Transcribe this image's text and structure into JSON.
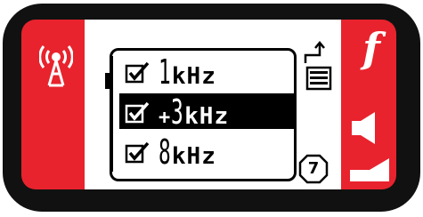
{
  "device": {
    "colors": {
      "frame": "#111111",
      "panel": "#e8232d",
      "screen": "#ffffff",
      "highlight": "#000000"
    }
  },
  "left_button": {
    "icon": "antenna-icon"
  },
  "menu": {
    "items": [
      {
        "checked": true,
        "prefix": "",
        "number": "1",
        "unit": "kHz",
        "selected": false
      },
      {
        "checked": true,
        "prefix": "+",
        "number": "3",
        "unit": "kHz",
        "selected": true
      },
      {
        "checked": true,
        "prefix": "",
        "number": "8",
        "unit": "kHz",
        "selected": false
      }
    ]
  },
  "screen_side": {
    "top_icon": "list-export-icon",
    "page_number": "7"
  },
  "right_buttons": {
    "top_icon": "function-icon",
    "top_glyph": "f",
    "middle_icon": "speaker-icon",
    "bottom_icon": "volume-level-icon"
  }
}
